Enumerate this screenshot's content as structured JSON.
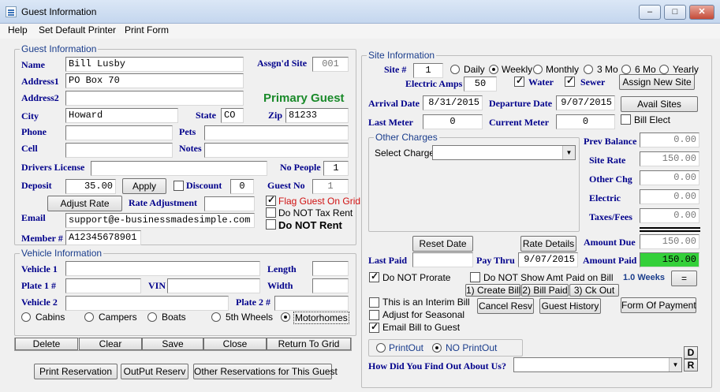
{
  "window": {
    "title": "Guest Information",
    "min": "–",
    "max": "□",
    "close": "✕"
  },
  "menu": [
    "Help",
    "Set Default Printer",
    "Print Form"
  ],
  "guest": {
    "legend": "Guest Information",
    "name_label": "Name",
    "name": "Bill Lusby",
    "assigned_site_label": "Assgn'd Site",
    "assigned_site": "001",
    "address1_label": "Address1",
    "address1": "PO Box 70",
    "address2_label": "Address2",
    "address2": "",
    "primary_guest": "Primary Guest",
    "city_label": "City",
    "city": "Howard",
    "state_label": "State",
    "state": "CO",
    "zip_label": "Zip",
    "zip": "81233",
    "phone_label": "Phone",
    "phone": "",
    "pets_label": "Pets",
    "pets": "",
    "cell_label": "Cell",
    "cell": "",
    "notes_label": "Notes",
    "notes": "",
    "drivers_license_label": "Drivers License",
    "drivers_license": "",
    "no_people_label": "No People",
    "no_people": "1",
    "deposit_label": "Deposit",
    "deposit": "35.00",
    "apply_btn": "Apply",
    "discount_label": "Discount",
    "discount": "0",
    "guest_no_label": "Guest No",
    "guest_no": "1",
    "adjust_rate_btn": "Adjust Rate",
    "rate_adjustment_label": "Rate Adjustment",
    "rate_adjustment": "",
    "flag_guest": "Flag Guest On Grid",
    "do_not_tax": "Do NOT Tax Rent",
    "do_not_rent": "Do NOT Rent",
    "email_label": "Email",
    "email": "support@e-businessmadesimple.com",
    "member_label": "Member #",
    "member": "A12345678901"
  },
  "vehicle": {
    "legend": "Vehicle Information",
    "vehicle1_label": "Vehicle 1",
    "vehicle1": "",
    "length_label": "Length",
    "length": "",
    "plate1_label": "Plate 1 #",
    "plate1": "",
    "vin_label": "VIN",
    "vin": "",
    "width_label": "Width",
    "width": "",
    "vehicle2_label": "Vehicle 2",
    "vehicle2": "",
    "plate2_label": "Plate 2 #",
    "plate2": "",
    "types": [
      "Cabins",
      "Campers",
      "Boats",
      "5th Wheels",
      "Motorhomes"
    ],
    "selected_type": "Motorhomes"
  },
  "actions": {
    "delete": "Delete",
    "clear": "Clear",
    "save": "Save",
    "close": "Close",
    "return_to_grid": "Return To Grid",
    "print_reservation": "Print Reservation",
    "output_reserv": "OutPut Reserv",
    "other_reservations": "Other Reservations for This Guest"
  },
  "site": {
    "legend": "Site Information",
    "site_label": "Site #",
    "site": "1",
    "periods": [
      "Daily",
      "Weekly",
      "Monthly",
      "3 Mo",
      "6 Mo",
      "Yearly"
    ],
    "selected_period": "Weekly",
    "electric_amps_label": "Electric Amps",
    "electric_amps": "50",
    "water_label": "Water",
    "sewer_label": "Sewer",
    "assign_new_site": "Assign New Site",
    "arrival_label": "Arrival Date",
    "arrival": "8/31/2015",
    "departure_label": "Departure Date",
    "departure": "9/07/2015",
    "avail_sites": "Avail Sites",
    "last_meter_label": "Last Meter",
    "last_meter": "0",
    "current_meter_label": "Current Meter",
    "current_meter": "0",
    "bill_elect": "Bill Elect"
  },
  "charges": {
    "legend": "Other Charges",
    "select_charge_label": "Select Charge",
    "select_charge": "",
    "prev_balance_label": "Prev Balance",
    "prev_balance": "0.00",
    "site_rate_label": "Site Rate",
    "site_rate": "150.00",
    "other_chg_label": "Other Chg",
    "other_chg": "0.00",
    "electric_label": "Electric",
    "electric": "0.00",
    "taxes_label": "Taxes/Fees",
    "taxes": "0.00",
    "reset_date": "Reset Date",
    "rate_details": "Rate Details",
    "amount_due_label": "Amount Due",
    "amount_due": "150.00",
    "last_paid_label": "Last Paid",
    "last_paid": "",
    "pay_thru_label": "Pay Thru",
    "pay_thru": "9/07/2015",
    "amount_paid_label": "Amount Paid",
    "amount_paid": "150.00",
    "do_not_prorate": "Do NOT Prorate",
    "do_not_show_amt": "Do NOT Show Amt Paid on Bill",
    "weeks": "1.0 Weeks",
    "equals": "=",
    "create_bill": "1) Create Bill",
    "bill_paid": "2) Bill Paid",
    "ck_out": "3) Ck Out",
    "interim_bill": "This is an Interim Bill",
    "cancel_resv": "Cancel Resv",
    "guest_history": "Guest History",
    "form_of_payment": "Form Of Payment",
    "adjust_seasonal": "Adjust for Seasonal",
    "email_bill": "Email Bill to Guest",
    "printout": "PrintOut",
    "no_printout": "NO PrintOut",
    "how_found_label": "How Did You Find Out About Us?",
    "how_found": "",
    "d_btn": "D",
    "r_btn": "R"
  }
}
